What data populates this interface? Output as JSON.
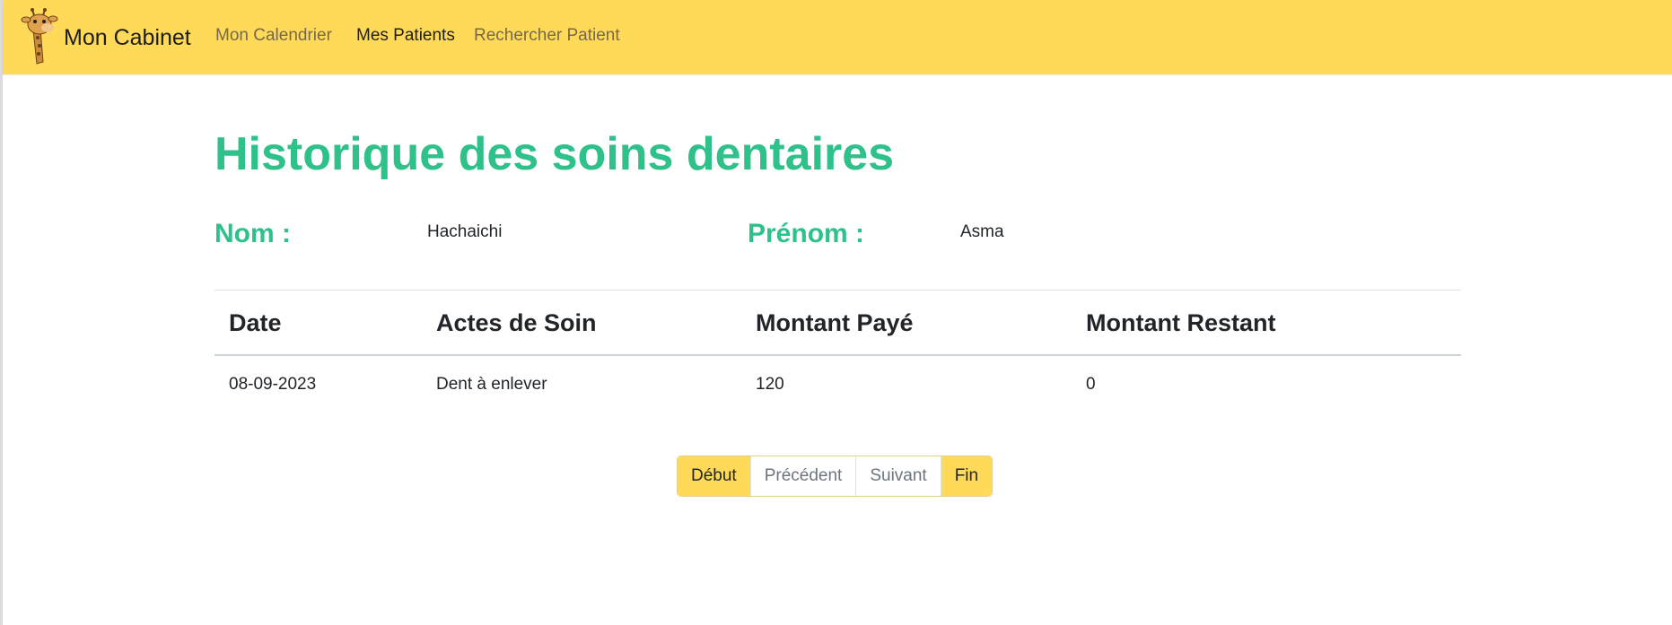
{
  "navbar": {
    "brand": "Mon Cabinet",
    "links": [
      "Mon Calendrier",
      "Mes Patients",
      "Rechercher Patient"
    ]
  },
  "page": {
    "title": "Historique des soins dentaires"
  },
  "patient": {
    "nom_label": "Nom :",
    "nom_value": "Hachaichi",
    "prenom_label": "Prénom :",
    "prenom_value": "Asma"
  },
  "table": {
    "headers": [
      "Date",
      "Actes de Soin",
      "Montant Payé",
      "Montant Restant"
    ],
    "rows": [
      [
        "08-09-2023",
        "Dent à enlever",
        "120",
        "0"
      ]
    ]
  },
  "pagination": {
    "buttons": [
      "Début",
      "Précédent",
      "Suivant",
      "Fin"
    ]
  },
  "colors": {
    "navbar": "#ffda58",
    "accent": "#2ec18a"
  }
}
